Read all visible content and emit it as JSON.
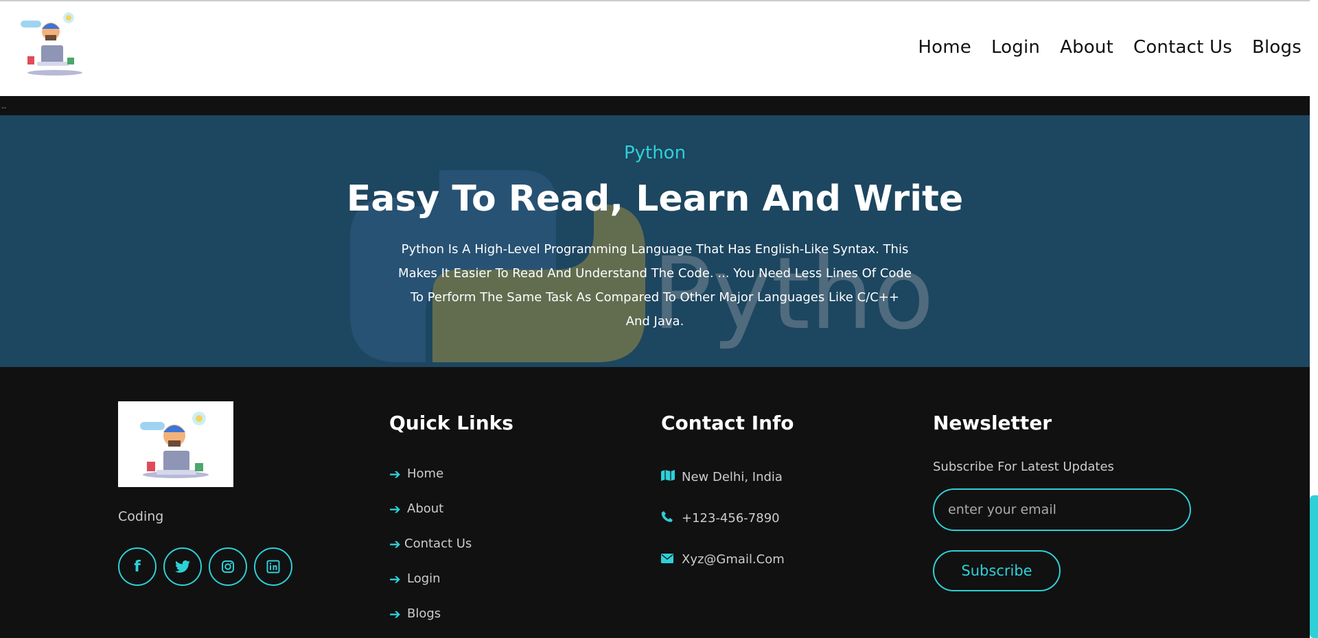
{
  "header": {
    "logo_alt": "Coding",
    "nav": [
      "Home",
      "Login",
      "About",
      "Contact Us",
      "Blogs"
    ]
  },
  "hero": {
    "eyebrow": "Python",
    "title": "Easy To Read, Learn And Write",
    "text": "Python Is A High-Level Programming Language That Has English-Like Syntax. This Makes It Easier To Read And Understand The Code. ... You Need Less Lines Of Code To Perform The Same Task As Compared To Other Major Languages Like C/C++ And Java.",
    "bg_word": "Python"
  },
  "footer": {
    "brand_name": "Coding",
    "socials": [
      "facebook-icon",
      "twitter-icon",
      "instagram-icon",
      "linkedin-icon"
    ],
    "quick_links": {
      "title": "Quick Links",
      "items": [
        "Home",
        "About",
        "Contact Us",
        "Login",
        "Blogs"
      ]
    },
    "contact": {
      "title": "Contact Info",
      "address": "New Delhi, India",
      "phone": "+123-456-7890",
      "email": "Xyz@Gmail.Com"
    },
    "newsletter": {
      "title": "Newsletter",
      "subtitle": "Subscribe For Latest Updates",
      "email_placeholder": "enter your email",
      "button": "Subscribe"
    }
  },
  "colors": {
    "accent": "#2ed0d8",
    "hero_bg": "#1d4660",
    "footer_bg": "#111111"
  }
}
